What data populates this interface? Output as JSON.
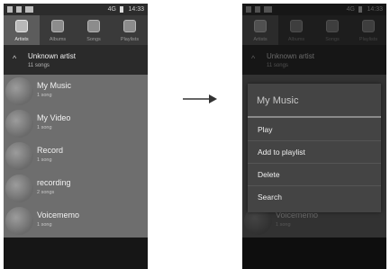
{
  "status_bar": {
    "time": "14:33",
    "signal": "4G"
  },
  "tabs": [
    {
      "label": "Artists",
      "icon": "microphone-icon"
    },
    {
      "label": "Albums",
      "icon": "album-icon"
    },
    {
      "label": "Songs",
      "icon": "music-note-icon"
    },
    {
      "label": "Playlists",
      "icon": "playlist-icon"
    }
  ],
  "header": {
    "title": "Unknown artist",
    "subtitle": "11 songs"
  },
  "albums": [
    {
      "name": "My Music",
      "count": "1 song"
    },
    {
      "name": "My Video",
      "count": "1 song"
    },
    {
      "name": "Record",
      "count": "1 song"
    },
    {
      "name": "recording",
      "count": "2 songs"
    },
    {
      "name": "Voicememo",
      "count": "1 song"
    }
  ],
  "context_menu": {
    "title": "My Music",
    "options": [
      "Play",
      "Add to playlist",
      "Delete",
      "Search"
    ]
  },
  "colors": {
    "active_tab": "#5c5c5c",
    "list_bg": "#6e6e6e",
    "dialog_bg": "#444444"
  }
}
